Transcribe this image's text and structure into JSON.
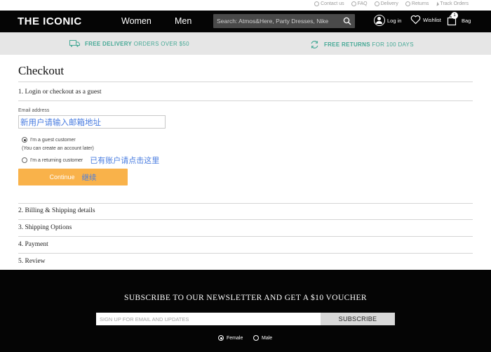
{
  "util_links": [
    {
      "label": "Contact us",
      "icon": "headset-icon"
    },
    {
      "label": "FAQ",
      "icon": "question-icon"
    },
    {
      "label": "Delivery",
      "icon": "clock-icon"
    },
    {
      "label": "Returns",
      "icon": "return-icon"
    },
    {
      "label": "Track Orders",
      "icon": "arrow-icon"
    }
  ],
  "nav": {
    "logo": "THE ICONIC",
    "women": "Women",
    "men": "Men",
    "search_placeholder": "Search: Atmos&Here, Party Dresses, Nike",
    "login": "Log in",
    "wishlist": "Wishlist",
    "bag": "Bag",
    "bag_count": "1"
  },
  "promo": {
    "delivery_bold": "FREE DELIVERY",
    "delivery_rest": "ORDERS OVER $50",
    "returns_bold": "FREE RETURNS",
    "returns_rest": "FOR 100 DAYS"
  },
  "checkout": {
    "title": "Checkout",
    "step1": "1. Login or checkout as a guest",
    "email_label": "Email address",
    "email_annotation": "新用户请输入邮箱地址",
    "guest_option": "I'm a guest customer",
    "guest_note": "(You can create an account later)",
    "returning_option": "I'm a returning customer",
    "returning_annotation": "已有账户请点击这里",
    "continue_label": "Continue",
    "continue_annotation": "继续",
    "step2": "2. Billing & Shipping details",
    "step3": "3. Shipping Options",
    "step4": "4. Payment",
    "step5": "5. Review"
  },
  "footer": {
    "newsletter_title": "SUBSCRIBE TO OUR NEWSLETTER AND GET A $10 VOUCHER",
    "email_placeholder": "SIGN UP FOR EMAIL AND UPDATES",
    "subscribe": "SUBSCRIBE",
    "female": "Female",
    "male": "Male"
  },
  "colors": {
    "nav_bg": "#050505",
    "promo_bg": "#e6e6e6",
    "promo_text": "#46a996",
    "continue_bg": "#f9b24a",
    "annotation": "#4a7de0"
  }
}
